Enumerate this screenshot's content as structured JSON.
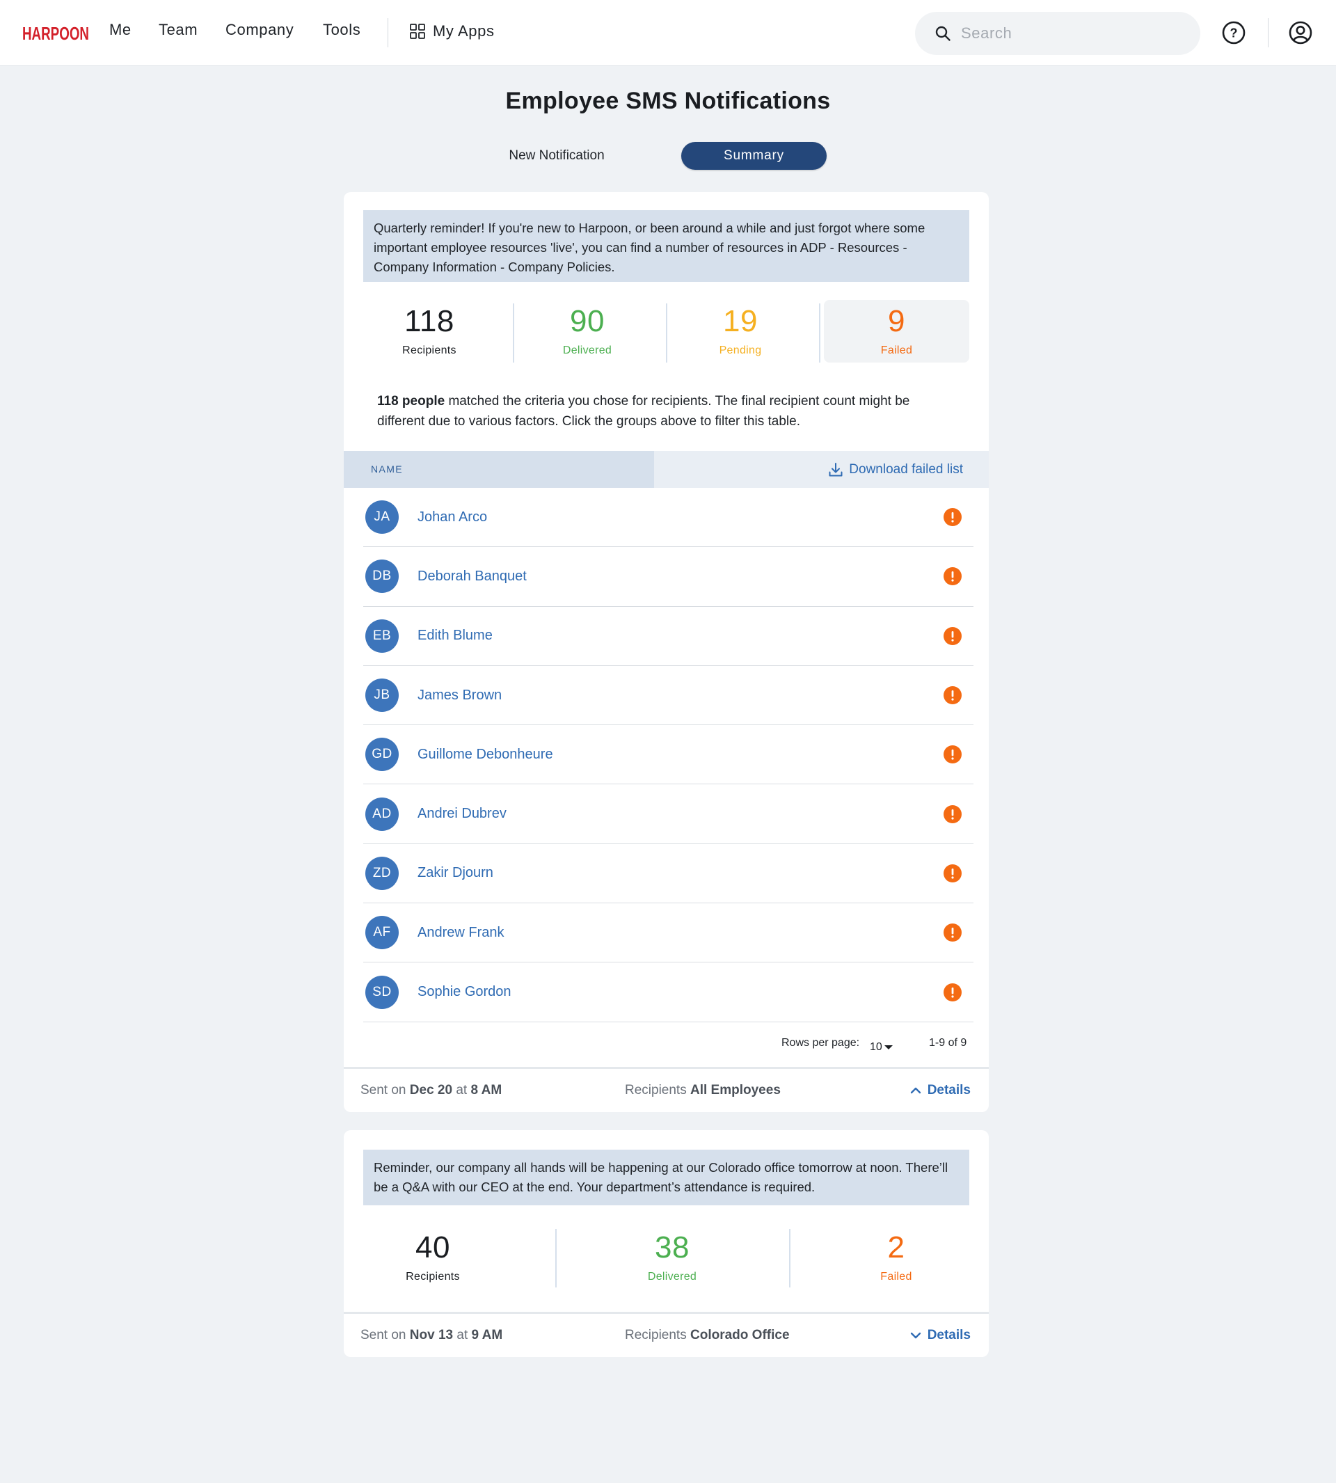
{
  "nav": {
    "logo_text": "HARPOON",
    "links": [
      "Me",
      "Team",
      "Company",
      "Tools"
    ],
    "my_apps_label": "My Apps",
    "search_placeholder": "Search",
    "help_icon": "help-icon",
    "user_icon": "user-circle-icon"
  },
  "page": {
    "title": "Employee SMS Notifications",
    "tabs": [
      {
        "label": "New Notification",
        "active": false
      },
      {
        "label": "Summary",
        "active": true
      }
    ]
  },
  "notifications": [
    {
      "message": "Quarterly reminder! If you're new to Harpoon, or been around a while and just forgot where some important employee resources 'live', you can find a number of resources in ADP - Resources - Company Information - Company Policies.",
      "stats": [
        {
          "value": "118",
          "label": "Recipients"
        },
        {
          "value": "90",
          "label": "Delivered"
        },
        {
          "value": "19",
          "label": "Pending"
        },
        {
          "value": "9",
          "label": "Failed",
          "selected": true
        }
      ],
      "criteria_bold": "118 people",
      "criteria_text": " matched the criteria you chose for recipients. The final recipient count might be different due to various factors. Click the groups above to filter this table.",
      "table": {
        "column_header": "NAME",
        "download_label": "Download failed list",
        "rows": [
          {
            "initials": "JA",
            "name": "Johan Arco",
            "status_icon": "alert-icon"
          },
          {
            "initials": "DB",
            "name": "Deborah Banquet",
            "status_icon": "alert-icon"
          },
          {
            "initials": "EB",
            "name": "Edith Blume",
            "status_icon": "alert-icon"
          },
          {
            "initials": "JB",
            "name": "James Brown",
            "status_icon": "alert-icon"
          },
          {
            "initials": "GD",
            "name": "Guillome Debonheure",
            "status_icon": "alert-icon"
          },
          {
            "initials": "AD",
            "name": "Andrei Dubrev",
            "status_icon": "alert-icon"
          },
          {
            "initials": "ZD",
            "name": "Zakir Djourn",
            "status_icon": "alert-icon"
          },
          {
            "initials": "AF",
            "name": "Andrew Frank",
            "status_icon": "alert-icon"
          },
          {
            "initials": "SD",
            "name": "Sophie Gordon",
            "status_icon": "alert-icon"
          }
        ],
        "rows_per_page_label": "Rows per page:",
        "rows_per_page_value": "10",
        "range": "1-9 of 9"
      },
      "footer": {
        "sent_prefix": "Sent on ",
        "sent_date": "Dec 20",
        "sent_at": " at ",
        "sent_time": "8 AM",
        "recipients_prefix": "Recipients ",
        "recipients_value": "All Employees",
        "details_label": "Details",
        "expanded": true
      }
    },
    {
      "message": "Reminder, our company all hands will be happening at our Colorado office tomorrow at noon. There’ll be a Q&A with our CEO at the end. Your department’s attendance is required.",
      "stats": [
        {
          "value": "40",
          "label": "Recipients"
        },
        {
          "value": "38",
          "label": "Delivered"
        },
        {
          "value": "2",
          "label": "Failed"
        }
      ],
      "footer": {
        "sent_prefix": "Sent on ",
        "sent_date": "Nov 13",
        "sent_at": " at ",
        "sent_time": "9 AM",
        "recipients_prefix": "Recipients ",
        "recipients_value": "Colorado Office",
        "details_label": "Details",
        "expanded": false
      }
    }
  ],
  "colors": {
    "brand_red": "#d3202a",
    "primary_navy": "#24477a",
    "link_blue": "#2f6bb3",
    "avatar_blue": "#3d75bb",
    "delivered_green": "#4caf50",
    "pending_yellow": "#f5b021",
    "failed_orange": "#f46a12",
    "message_bg": "#d6e0ec"
  }
}
